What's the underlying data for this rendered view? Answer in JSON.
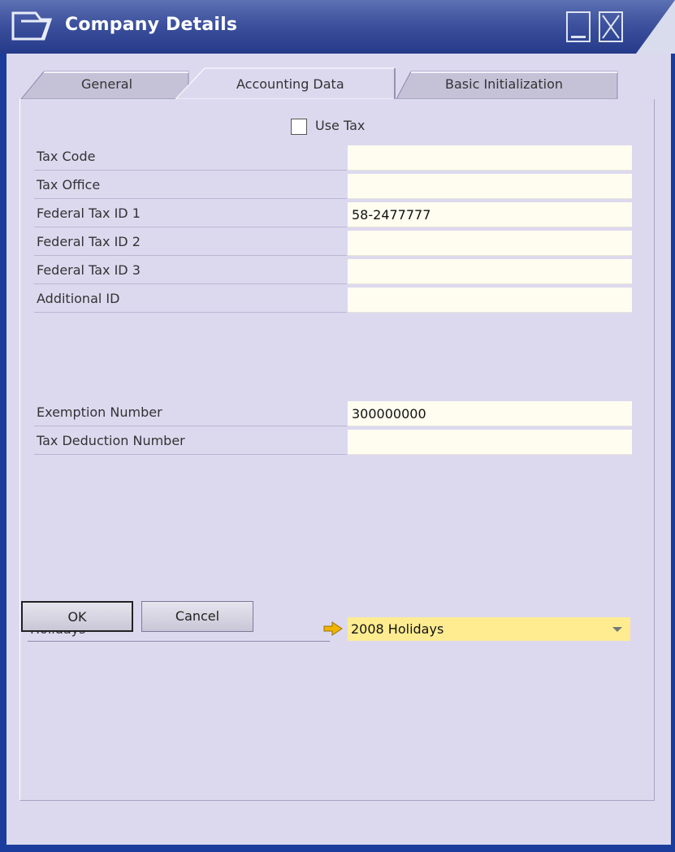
{
  "window": {
    "title": "Company Details"
  },
  "tabs": [
    {
      "label": "General",
      "active": false
    },
    {
      "label": "Accounting Data",
      "active": true
    },
    {
      "label": "Basic Initialization",
      "active": false
    }
  ],
  "use_tax": {
    "label": "Use Tax",
    "checked": false
  },
  "fields": [
    {
      "label": "Tax Code",
      "value": ""
    },
    {
      "label": "Tax Office",
      "value": ""
    },
    {
      "label": "Federal Tax ID 1",
      "value": "58-2477777"
    },
    {
      "label": "Federal Tax ID 2",
      "value": ""
    },
    {
      "label": "Federal Tax ID 3",
      "value": ""
    },
    {
      "label": "Additional ID",
      "value": ""
    },
    {
      "label": "Exemption Number",
      "value": "300000000"
    },
    {
      "label": "Tax Deduction Number",
      "value": ""
    }
  ],
  "holidays": {
    "label": "Holidays",
    "selected": "2008 Holidays"
  },
  "buttons": {
    "ok": "OK",
    "cancel": "Cancel"
  },
  "colors": {
    "title_bar": "#3d519d",
    "client_background": "#dcd9ef",
    "field_background": "#fefdf0",
    "dropdown_highlight": "#ffec91",
    "link_arrow": "#e2a400"
  }
}
